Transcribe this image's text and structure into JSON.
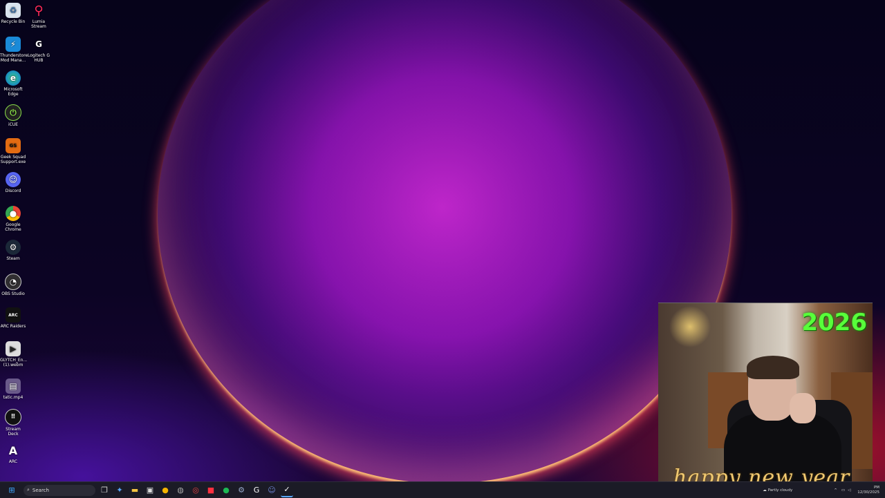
{
  "desktop_icons": [
    {
      "label": "Recycle Bin",
      "icon": "recycle-bin-icon",
      "col": 0
    },
    {
      "label": "Lumia Stream",
      "icon": "lumia-stream-icon",
      "col": 1
    },
    {
      "label": "Thunderstore Mod Mana...",
      "icon": "thunderstore-icon",
      "col": 0
    },
    {
      "label": "Logitech G HUB",
      "icon": "logitech-g-icon",
      "col": 1
    },
    {
      "label": "Microsoft Edge",
      "icon": "edge-icon",
      "col": 0
    },
    {
      "label": "iCUE",
      "icon": "icue-icon",
      "col": 0
    },
    {
      "label": "Geek Squad Support.exe",
      "icon": "geek-squad-icon",
      "col": 0
    },
    {
      "label": "Discord",
      "icon": "discord-icon",
      "col": 0
    },
    {
      "label": "Google Chrome",
      "icon": "chrome-icon",
      "col": 0
    },
    {
      "label": "Steam",
      "icon": "steam-icon",
      "col": 0
    },
    {
      "label": "OBS Studio",
      "icon": "obs-icon",
      "col": 0
    },
    {
      "label": "ARC Raiders",
      "icon": "arc-raiders-icon",
      "col": 0
    },
    {
      "label": "GLYTCH_En... (1).webm",
      "icon": "video-file-icon",
      "col": 0
    },
    {
      "label": "tatic.mp4",
      "icon": "video-file-icon",
      "col": 0
    },
    {
      "label": "Stream Deck",
      "icon": "stream-deck-icon",
      "col": 0
    },
    {
      "label": "ARC",
      "icon": "arc-icon",
      "col": 0
    }
  ],
  "taskbar": {
    "search_label": "Search",
    "weather": "Partly cloudy",
    "time": "PM",
    "date": "12/30/2025"
  },
  "webcam": {
    "year_text": "2026",
    "greeting": "happy new year"
  }
}
